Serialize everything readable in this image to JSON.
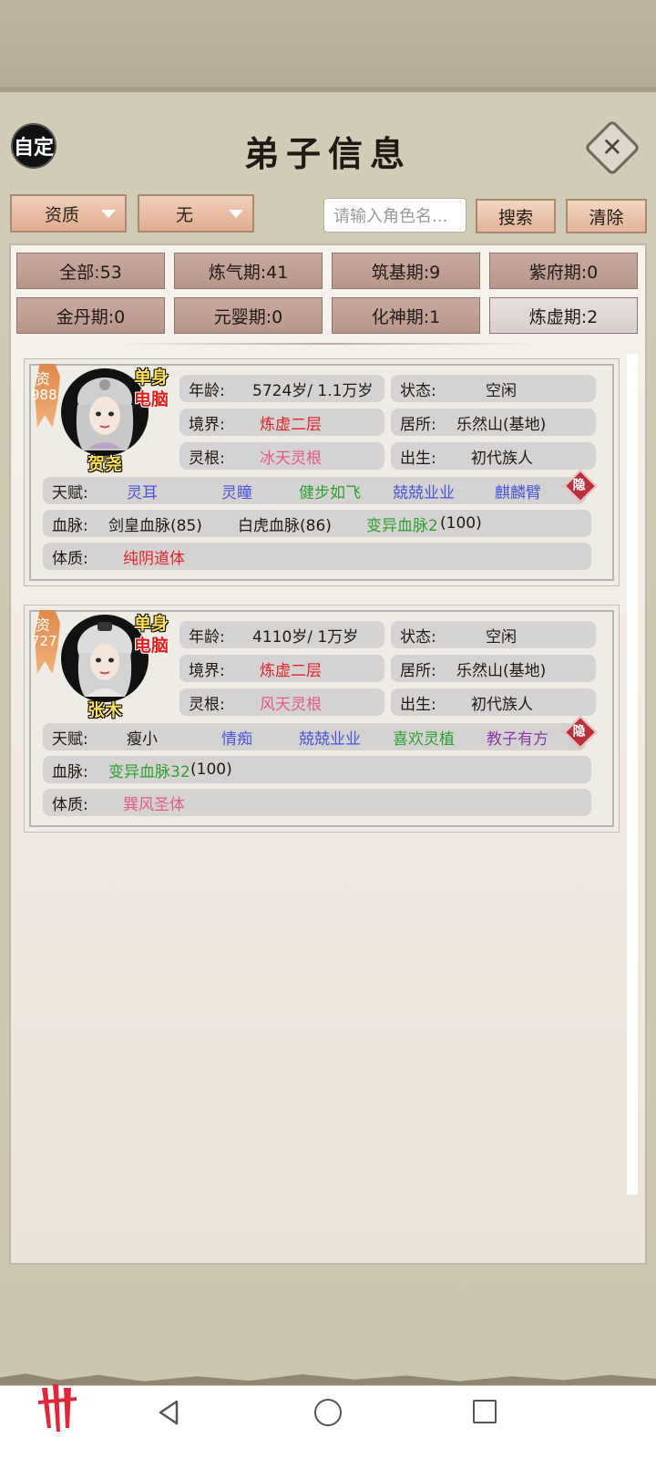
{
  "header": {
    "auto_label": "自定",
    "title": "弟子信息",
    "close_icon": "close-icon"
  },
  "filters": {
    "attribute": "资质",
    "value": "无",
    "search_placeholder": "请输入角色名...",
    "search_label": "搜索",
    "clear_label": "清除"
  },
  "stages": [
    {
      "label": "全部:53"
    },
    {
      "label": "炼气期:41"
    },
    {
      "label": "筑基期:9"
    },
    {
      "label": "紫府期:0"
    },
    {
      "label": "金丹期:0"
    },
    {
      "label": "元婴期:0"
    },
    {
      "label": "化神期:1"
    },
    {
      "label": "炼虚期:2",
      "active": true
    }
  ],
  "disciples": [
    {
      "grade_char": "资",
      "grade": "988",
      "tag_single": "单身",
      "tag_pc": "电脑",
      "name": "贺尧",
      "age_label": "年龄:",
      "age": "5724岁/ 1.1万岁",
      "status_label": "状态:",
      "status": "空闲",
      "realm_label": "境界:",
      "realm": "炼虚二层",
      "residence_label": "居所:",
      "residence": "乐然山(基地)",
      "root_label": "灵根:",
      "root": "冰天灵根",
      "birth_label": "出生:",
      "birth": "初代族人",
      "talent_label": "天赋:",
      "talents": [
        "灵耳",
        "灵瞳",
        "健步如飞",
        "兢兢业业",
        "麒麟臂"
      ],
      "hide_label": "隐",
      "bloodline_label": "血脉:",
      "bloodlines": [
        "剑皇血脉(85)",
        "白虎血脉(86)",
        "变异血脉2",
        "(100)"
      ],
      "physique_label": "体质:",
      "physique": "纯阴道体"
    },
    {
      "grade_char": "资",
      "grade": "727",
      "tag_single": "单身",
      "tag_pc": "电脑",
      "name": "张木",
      "age_label": "年龄:",
      "age": "4110岁/ 1万岁",
      "status_label": "状态:",
      "status": "空闲",
      "realm_label": "境界:",
      "realm": "炼虚二层",
      "residence_label": "居所:",
      "residence": "乐然山(基地)",
      "root_label": "灵根:",
      "root": "风天灵根",
      "birth_label": "出生:",
      "birth": "初代族人",
      "talent_label": "天赋:",
      "talents": [
        "瘦小",
        "情痴",
        "兢兢业业",
        "喜欢灵植",
        "教子有方"
      ],
      "hide_label": "隐",
      "bloodline_label": "血脉:",
      "bloodlines": [
        "变异血脉32",
        "(100)"
      ],
      "physique_label": "体质:",
      "physique": "巽风圣体"
    }
  ],
  "colors": {
    "red": "#e0232a",
    "pink": "#e05a8a",
    "blue": "#4a55d6",
    "green": "#2f9e35",
    "purple": "#8a3aa8"
  },
  "navbar": {
    "back_icon": "back-icon",
    "home_icon": "home-icon",
    "recent_icon": "recent-apps-icon"
  }
}
